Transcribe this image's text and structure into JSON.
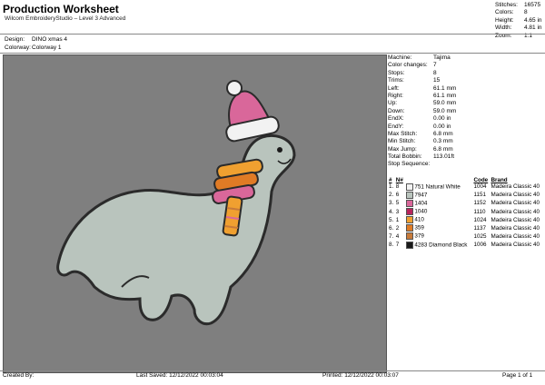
{
  "header": {
    "title": "Production Worksheet",
    "subtitle": "Wilcom EmbroideryStudio – Level 3 Advanced",
    "design_label": "Design:",
    "design_value": "DINO xmas 4",
    "colorway_label": "Colorway:",
    "colorway_value": "Colorway 1"
  },
  "summary": [
    {
      "label": "Stitches:",
      "value": "16575"
    },
    {
      "label": "Colors:",
      "value": "8"
    },
    {
      "label": "Height:",
      "value": "4.65 in"
    },
    {
      "label": "Width:",
      "value": "4.81 in"
    },
    {
      "label": "Zoom:",
      "value": "1:1"
    }
  ],
  "machine_info": [
    {
      "label": "Machine:",
      "value": "Tajima"
    },
    {
      "label": "Color changes:",
      "value": "7"
    },
    {
      "label": "Stops:",
      "value": "8"
    },
    {
      "label": "Trims:",
      "value": "15"
    },
    {
      "label": "Left:",
      "value": "61.1 mm"
    },
    {
      "label": "Right:",
      "value": "61.1 mm"
    },
    {
      "label": "Up:",
      "value": "59.0 mm"
    },
    {
      "label": "Down:",
      "value": "59.0 mm"
    },
    {
      "label": "EndX:",
      "value": "0.00 in"
    },
    {
      "label": "EndY:",
      "value": "0.00 in"
    },
    {
      "label": "Max Stitch:",
      "value": "6.8 mm"
    },
    {
      "label": "Min Stitch:",
      "value": "0.3 mm"
    },
    {
      "label": "Max Jump:",
      "value": "6.8 mm"
    },
    {
      "label": "Total Bobbin:",
      "value": "113.01ft"
    },
    {
      "label": "Stop Sequence:",
      "value": ""
    }
  ],
  "stop_table": {
    "headers": [
      "#",
      "N#",
      "",
      "Code",
      "Brand"
    ],
    "rows": [
      {
        "stop": "1.",
        "needle": "8",
        "color": "#f2f2f2",
        "num": "751",
        "name": "Natural White",
        "code": "1004",
        "brand": "Madeira Classic 40"
      },
      {
        "stop": "2.",
        "needle": "6",
        "color": "#b9c4bd",
        "num": "7947",
        "name": "",
        "code": "1151",
        "brand": "Madeira Classic 40"
      },
      {
        "stop": "3.",
        "needle": "5",
        "color": "#d9679a",
        "num": "1404",
        "name": "",
        "code": "1152",
        "brand": "Madeira Classic 40"
      },
      {
        "stop": "4.",
        "needle": "3",
        "color": "#b8245c",
        "num": "1040",
        "name": "",
        "code": "1110",
        "brand": "Madeira Classic 40"
      },
      {
        "stop": "5.",
        "needle": "1",
        "color": "#f0a030",
        "num": "410",
        "name": "",
        "code": "1024",
        "brand": "Madeira Classic 40"
      },
      {
        "stop": "6.",
        "needle": "2",
        "color": "#e07b25",
        "num": "359",
        "name": "",
        "code": "1137",
        "brand": "Madeira Classic 40"
      },
      {
        "stop": "7.",
        "needle": "4",
        "color": "#c77a3a",
        "num": "379",
        "name": "",
        "code": "1025",
        "brand": "Madeira Classic 40"
      },
      {
        "stop": "8.",
        "needle": "7",
        "color": "#1a1a1a",
        "num": "4283",
        "name": "Diamond Black",
        "code": "1006",
        "brand": "Madeira Classic 40"
      }
    ]
  },
  "footer": {
    "created_by": "Created By:",
    "last_saved": "Last Saved: 12/12/2022 00:03:04",
    "printed": "Printed: 12/12/2022 00:03:07",
    "page": "Page 1 of 1"
  },
  "colors": {
    "canvas": "#7f7f7f",
    "body_fill": "#b9c4bd",
    "outline": "#2b2b2b",
    "hat": "#d9679a",
    "hat_trim": "#f2f2f2"
  }
}
